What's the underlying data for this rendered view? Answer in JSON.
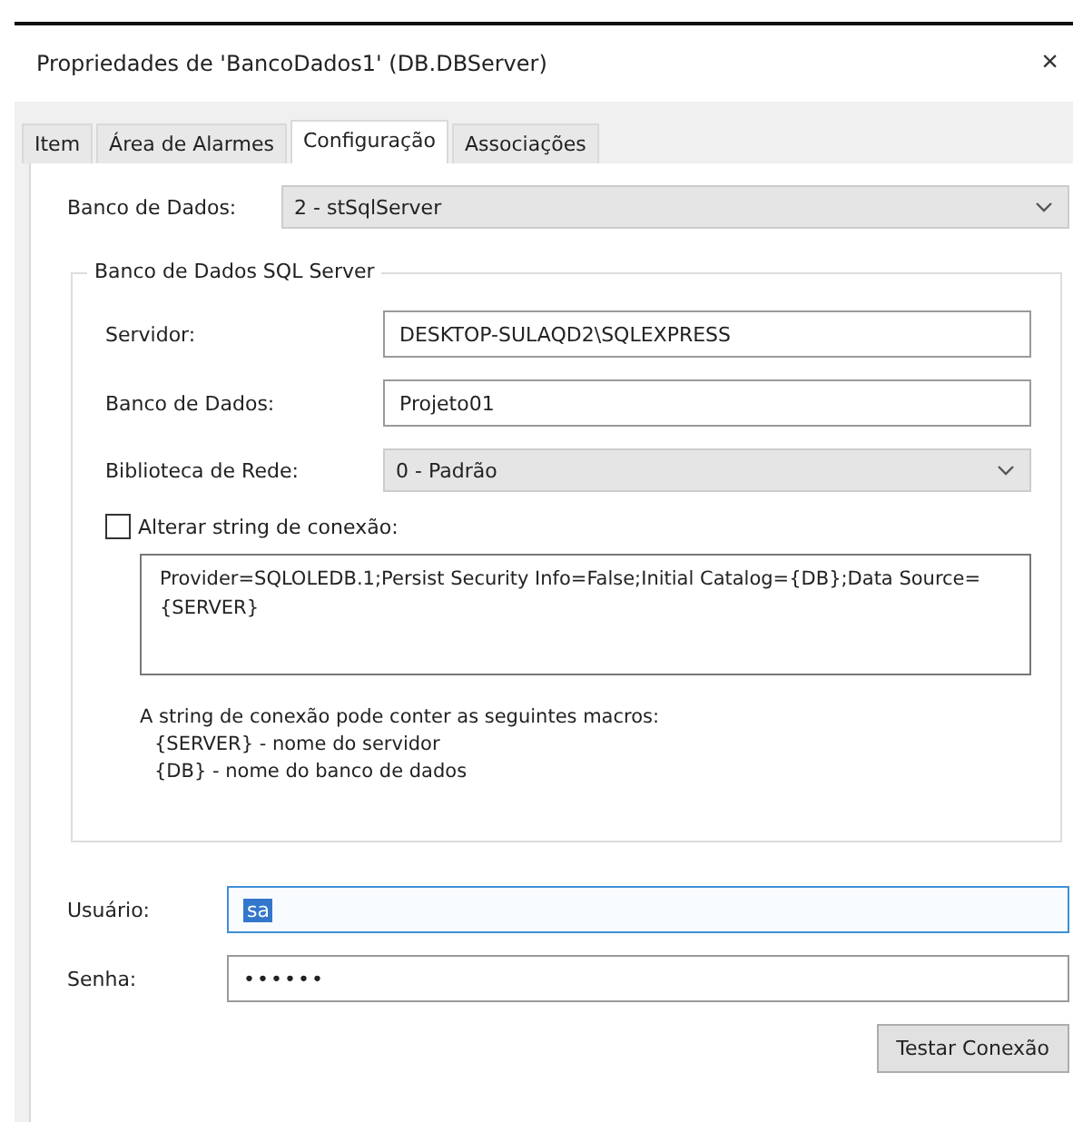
{
  "window": {
    "title": "Propriedades de 'BancoDados1' (DB.DBServer)",
    "close": "×"
  },
  "tabs": [
    {
      "label": "Item",
      "selected": false
    },
    {
      "label": "Área de Alarmes",
      "selected": false
    },
    {
      "label": "Configuração",
      "selected": true
    },
    {
      "label": "Associações",
      "selected": false
    }
  ],
  "database": {
    "label": "Banco de Dados:",
    "value": "2 - stSqlServer"
  },
  "group": {
    "title": "Banco de Dados SQL Server",
    "fields": [
      {
        "kind": "text",
        "label": "Servidor:",
        "value": "DESKTOP-SULAQD2\\SQLEXPRESS"
      },
      {
        "kind": "text",
        "label": "Banco de Dados:",
        "value": "Projeto01"
      },
      {
        "kind": "select",
        "label": "Biblioteca de Rede:",
        "value": "0 - Padrão"
      }
    ],
    "checkbox": {
      "label": "Alterar string de conexão:",
      "checked": false
    },
    "connection_string": "Provider=SQLOLEDB.1;Persist Security Info=False;Initial Catalog={DB};Data Source={SERVER}",
    "help": [
      "A string de conexão pode conter as seguintes macros:",
      "{SERVER} - nome do servidor",
      "{DB} - nome do banco de dados"
    ]
  },
  "credentials": [
    {
      "label": "Usuário:",
      "value": "sa",
      "focused": true
    },
    {
      "label": "Senha:",
      "value": "••••••",
      "focused": false
    }
  ],
  "button": "Testar Conexão"
}
